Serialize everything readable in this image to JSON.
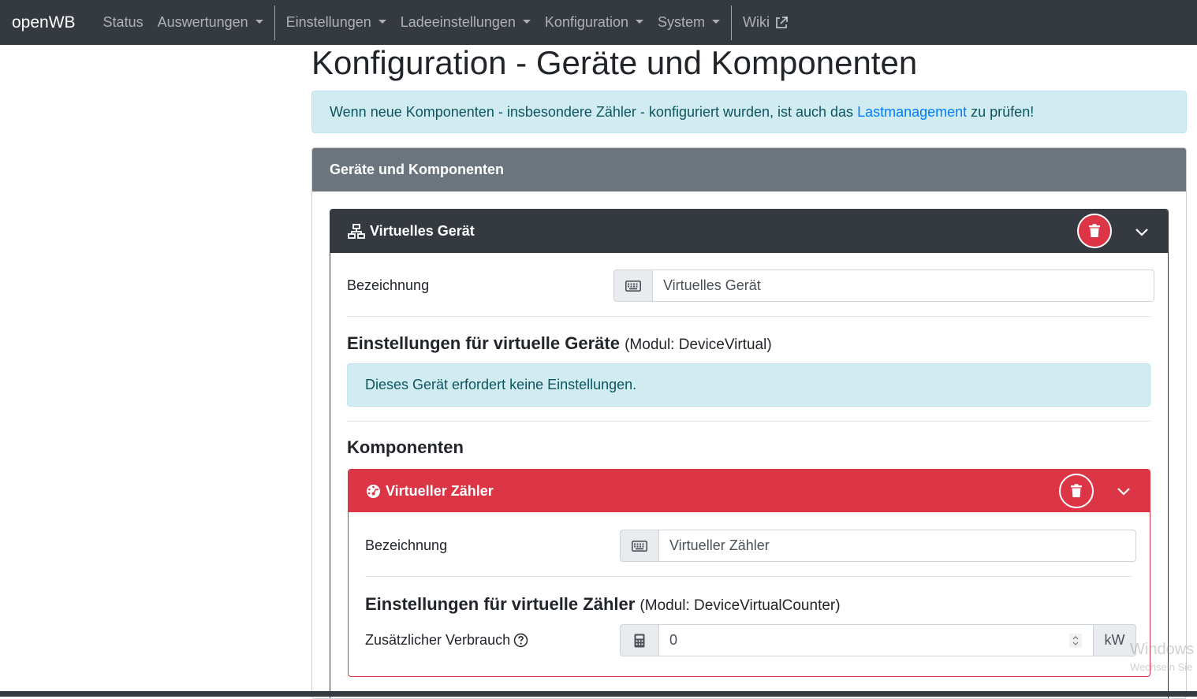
{
  "navbar": {
    "brand": "openWB",
    "items": [
      {
        "label": "Status"
      },
      {
        "label": "Auswertungen"
      },
      {
        "label": "Einstellungen"
      },
      {
        "label": "Ladeeinstellungen"
      },
      {
        "label": "Konfiguration"
      },
      {
        "label": "System"
      },
      {
        "label": "Wiki"
      }
    ]
  },
  "page": {
    "title": "Konfiguration - Geräte und Komponenten"
  },
  "info_alert": {
    "text_before": "Wenn neue Komponenten - insbesondere Zähler - konfiguriert wurden, ist auch das",
    "link": "Lastmanagement",
    "text_after": "zu prüfen!"
  },
  "outer_card": {
    "title": "Geräte und Komponenten"
  },
  "device": {
    "title": "Virtuelles Gerät",
    "name_label": "Bezeichnung",
    "name_value": "Virtuelles Gerät",
    "settings_heading": "Einstellungen für virtuelle Geräte",
    "settings_module": "(Modul: DeviceVirtual)",
    "no_settings_text": "Dieses Gerät erfordert keine Einstellungen.",
    "components_heading": "Komponenten"
  },
  "component": {
    "title": "Virtueller Zähler",
    "name_label": "Bezeichnung",
    "name_value": "Virtueller Zähler",
    "settings_heading": "Einstellungen für virtuelle Zähler",
    "settings_module": "(Modul: DeviceVirtualCounter)",
    "extra_label": "Zusätzlicher Verbrauch",
    "extra_value": "0",
    "extra_unit": "kW"
  },
  "watermark": {
    "line1": "Windows",
    "line2": "Wechseln Sie"
  },
  "colors": {
    "navbar": "#343a40",
    "danger": "#dc3545",
    "secondary": "#6c757d",
    "info_bg": "#d1ecf1",
    "link": "#007bff"
  }
}
